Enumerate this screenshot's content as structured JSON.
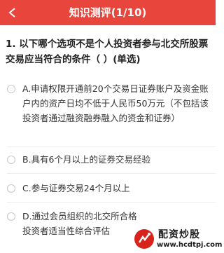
{
  "header": {
    "title": "知识测评(1/10)",
    "background": "#e8453c"
  },
  "question": {
    "text": "1. 以下哪个选项不是个人投资者参与北交所股票交易应当符合的条件（  ）(单选)"
  },
  "options": [
    {
      "text": "A.申请权限开通前20个交易日证券账户及资金账户内的资产日均不低于人民币50万元（不包括该投资者通过融资融券融入的资金和证券）"
    },
    {
      "text": "B.具有6个月以上的证券交易经验"
    },
    {
      "text": "C.参与证券交易24个月以上"
    },
    {
      "text": "D.通过会员组织的北交所合格投资者适当性综合评估"
    }
  ],
  "watermark": {
    "title": "配资炒股",
    "url": "www.hcdtpj.com"
  }
}
